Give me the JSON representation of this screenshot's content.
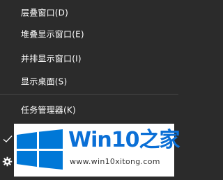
{
  "context_menu": {
    "items": [
      {
        "label": "层叠窗口(D)"
      },
      {
        "label": "堆叠显示窗口(E)"
      },
      {
        "label": "并排显示窗口(I)"
      },
      {
        "label": "显示桌面(S)"
      },
      {
        "label": "任务管理器(K)"
      }
    ]
  },
  "watermark": {
    "title": "Win10之家",
    "url": "www.win10xitong.com"
  },
  "icons": {
    "check": "check-icon",
    "settings": "gear-icon",
    "logo": "windows-logo-icon"
  },
  "colors": {
    "menu_background": "#2b2b2b",
    "menu_text": "#ffffff",
    "separator": "#484848",
    "brand_blue": "#0a6fd6",
    "logo_blue": "#0078d7"
  }
}
